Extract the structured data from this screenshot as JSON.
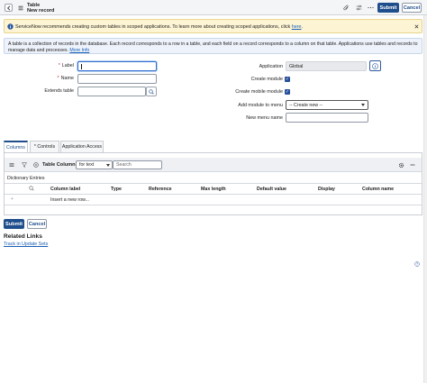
{
  "header": {
    "title_line1": "Table",
    "title_line2": "New record",
    "submit_label": "Submit",
    "cancel_label": "Cancel"
  },
  "info_banner": {
    "text": "ServiceNow recommends creating custom tables in scoped applications. To learn more about creating scoped applications, click",
    "link_text": "here",
    "after_link": "."
  },
  "description": {
    "text": "A table is a collection of records in the database. Each record corresponds to a row in a table, and each field on a record corresponds to a column on that table. Applications use tables and records to manage data and processes.",
    "link_text": "More Info"
  },
  "form": {
    "label_field": {
      "label": "Label",
      "value": ""
    },
    "name_field": {
      "label": "Name",
      "value": ""
    },
    "extends_field": {
      "label": "Extends table",
      "value": ""
    },
    "application_field": {
      "label": "Application",
      "value": "Global"
    },
    "create_module": {
      "label": "Create module",
      "checked": true
    },
    "create_mobile_module": {
      "label": "Create mobile module",
      "checked": true
    },
    "add_module_to_menu": {
      "label": "Add module to menu",
      "value": "-- Create new --"
    },
    "new_menu_name": {
      "label": "New menu name",
      "value": ""
    }
  },
  "tabs": [
    {
      "label": "Columns",
      "active": true
    },
    {
      "label": "* Controls",
      "active": false
    },
    {
      "label": "Application Access",
      "active": false
    }
  ],
  "list": {
    "title": "Table Columns",
    "filter_select": "for text",
    "search_placeholder": "Search",
    "breadcrumb": "Dictionary Entries",
    "columns": [
      "Column label",
      "Type",
      "Reference",
      "Max length",
      "Default value",
      "Display",
      "Column name"
    ],
    "insert_row": "Insert a new row..."
  },
  "footer": {
    "submit_label": "Submit",
    "cancel_label": "Cancel",
    "related_links_title": "Related Links",
    "related_link": "Track in Update Sets"
  }
}
